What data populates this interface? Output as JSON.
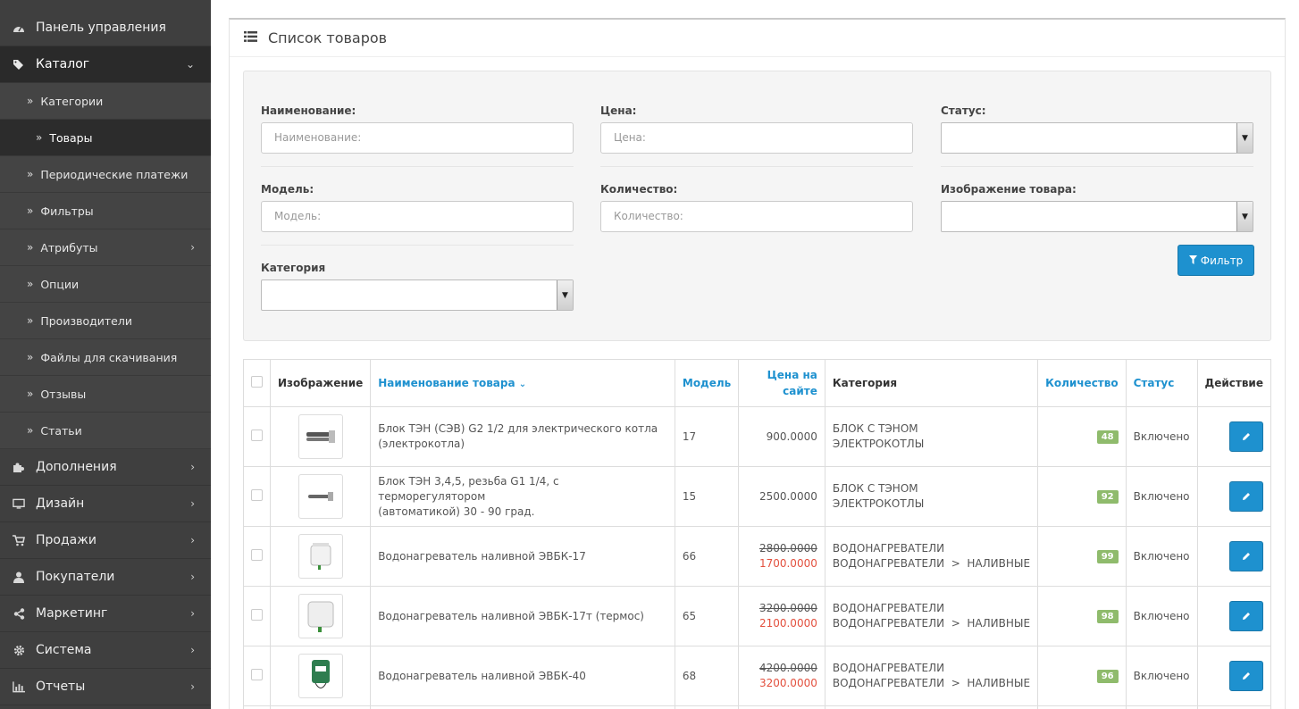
{
  "sidebar": {
    "items": [
      {
        "label": "Панель управления",
        "icon": "dashboard-icon"
      },
      {
        "label": "Каталог",
        "icon": "tags-icon"
      },
      {
        "label": "Категории"
      },
      {
        "label": "Товары"
      },
      {
        "label": "Периодические платежи"
      },
      {
        "label": "Фильтры"
      },
      {
        "label": "Атрибуты"
      },
      {
        "label": "Опции"
      },
      {
        "label": "Производители"
      },
      {
        "label": "Файлы для скачивания"
      },
      {
        "label": "Отзывы"
      },
      {
        "label": "Статьи"
      },
      {
        "label": "Дополнения",
        "icon": "puzzle-icon"
      },
      {
        "label": "Дизайн",
        "icon": "monitor-icon"
      },
      {
        "label": "Продажи",
        "icon": "cart-icon"
      },
      {
        "label": "Покупатели",
        "icon": "user-icon"
      },
      {
        "label": "Маркетинг",
        "icon": "share-icon"
      },
      {
        "label": "Система",
        "icon": "gear-icon"
      },
      {
        "label": "Отчеты",
        "icon": "bar-chart-icon"
      }
    ]
  },
  "panel": {
    "title": "Список товаров"
  },
  "filter": {
    "name_label": "Наименование:",
    "name_placeholder": "Наименование:",
    "price_label": "Цена:",
    "price_placeholder": "Цена:",
    "status_label": "Статус:",
    "status_value": "",
    "model_label": "Модель:",
    "model_placeholder": "Модель:",
    "quantity_label": "Количество:",
    "quantity_placeholder": "Количество:",
    "image_label": "Изображение товара:",
    "image_value": "",
    "category_label": "Категория",
    "category_value": "",
    "button_label": "Фильтр"
  },
  "table": {
    "headers": {
      "image": "Изображение",
      "name": "Наименование товара",
      "model": "Модель",
      "price_line1": "Цена на",
      "price_line2": "сайте",
      "category": "Категория",
      "quantity": "Количество",
      "status": "Статус",
      "action": "Действие"
    },
    "rows": [
      {
        "name_line1": "Блок ТЭН (СЭВ) G2 1/2 для электрического котла",
        "name_line2": "(электрокотла)",
        "model": "17",
        "price": "900.0000",
        "special": "",
        "cat_line1": "БЛОК С ТЭНОМ",
        "cat_line2": "ЭЛЕКТРОКОТЛЫ",
        "quantity": "48",
        "status": "Включено",
        "image_icon": "heating-element-image"
      },
      {
        "name_line1": "Блок ТЭН 3,4,5, резьба G1 1/4, с терморегулятором",
        "name_line2": "(автоматикой) 30 - 90 град.",
        "model": "15",
        "price": "2500.0000",
        "special": "",
        "cat_line1": "БЛОК С ТЭНОМ",
        "cat_line2": "ЭЛЕКТРОКОТЛЫ",
        "quantity": "92",
        "status": "Включено",
        "image_icon": "heating-element-image"
      },
      {
        "name_line1": "Водонагреватель наливной ЭВБК-17",
        "name_line2": "",
        "model": "66",
        "price": "2800.0000",
        "special": "1700.0000",
        "cat_line1": "ВОДОНАГРЕВАТЕЛИ",
        "cat_line2": "ВОДОНАГРЕВАТЕЛИ  >  НАЛИВНЫЕ",
        "quantity": "99",
        "status": "Включено",
        "image_icon": "water-heater-image"
      },
      {
        "name_line1": "Водонагреватель наливной ЭВБК-17т (термос)",
        "name_line2": "",
        "model": "65",
        "price": "3200.0000",
        "special": "2100.0000",
        "cat_line1": "ВОДОНАГРЕВАТЕЛИ",
        "cat_line2": "ВОДОНАГРЕВАТЕЛИ  >  НАЛИВНЫЕ",
        "quantity": "98",
        "status": "Включено",
        "image_icon": "water-heater-image"
      },
      {
        "name_line1": "Водонагреватель наливной ЭВБК-40",
        "name_line2": "",
        "model": "68",
        "price": "4200.0000",
        "special": "3200.0000",
        "cat_line1": "ВОДОНАГРЕВАТЕЛИ",
        "cat_line2": "ВОДОНАГРЕВАТЕЛИ  >  НАЛИВНЫЕ",
        "quantity": "96",
        "status": "Включено",
        "image_icon": "green-water-heater-image"
      }
    ]
  },
  "colors": {
    "sidebar_bg": "#3f3f3f",
    "accent": "#1e91cf",
    "badge": "#8fbb6c",
    "special_price": "#e3503e"
  }
}
